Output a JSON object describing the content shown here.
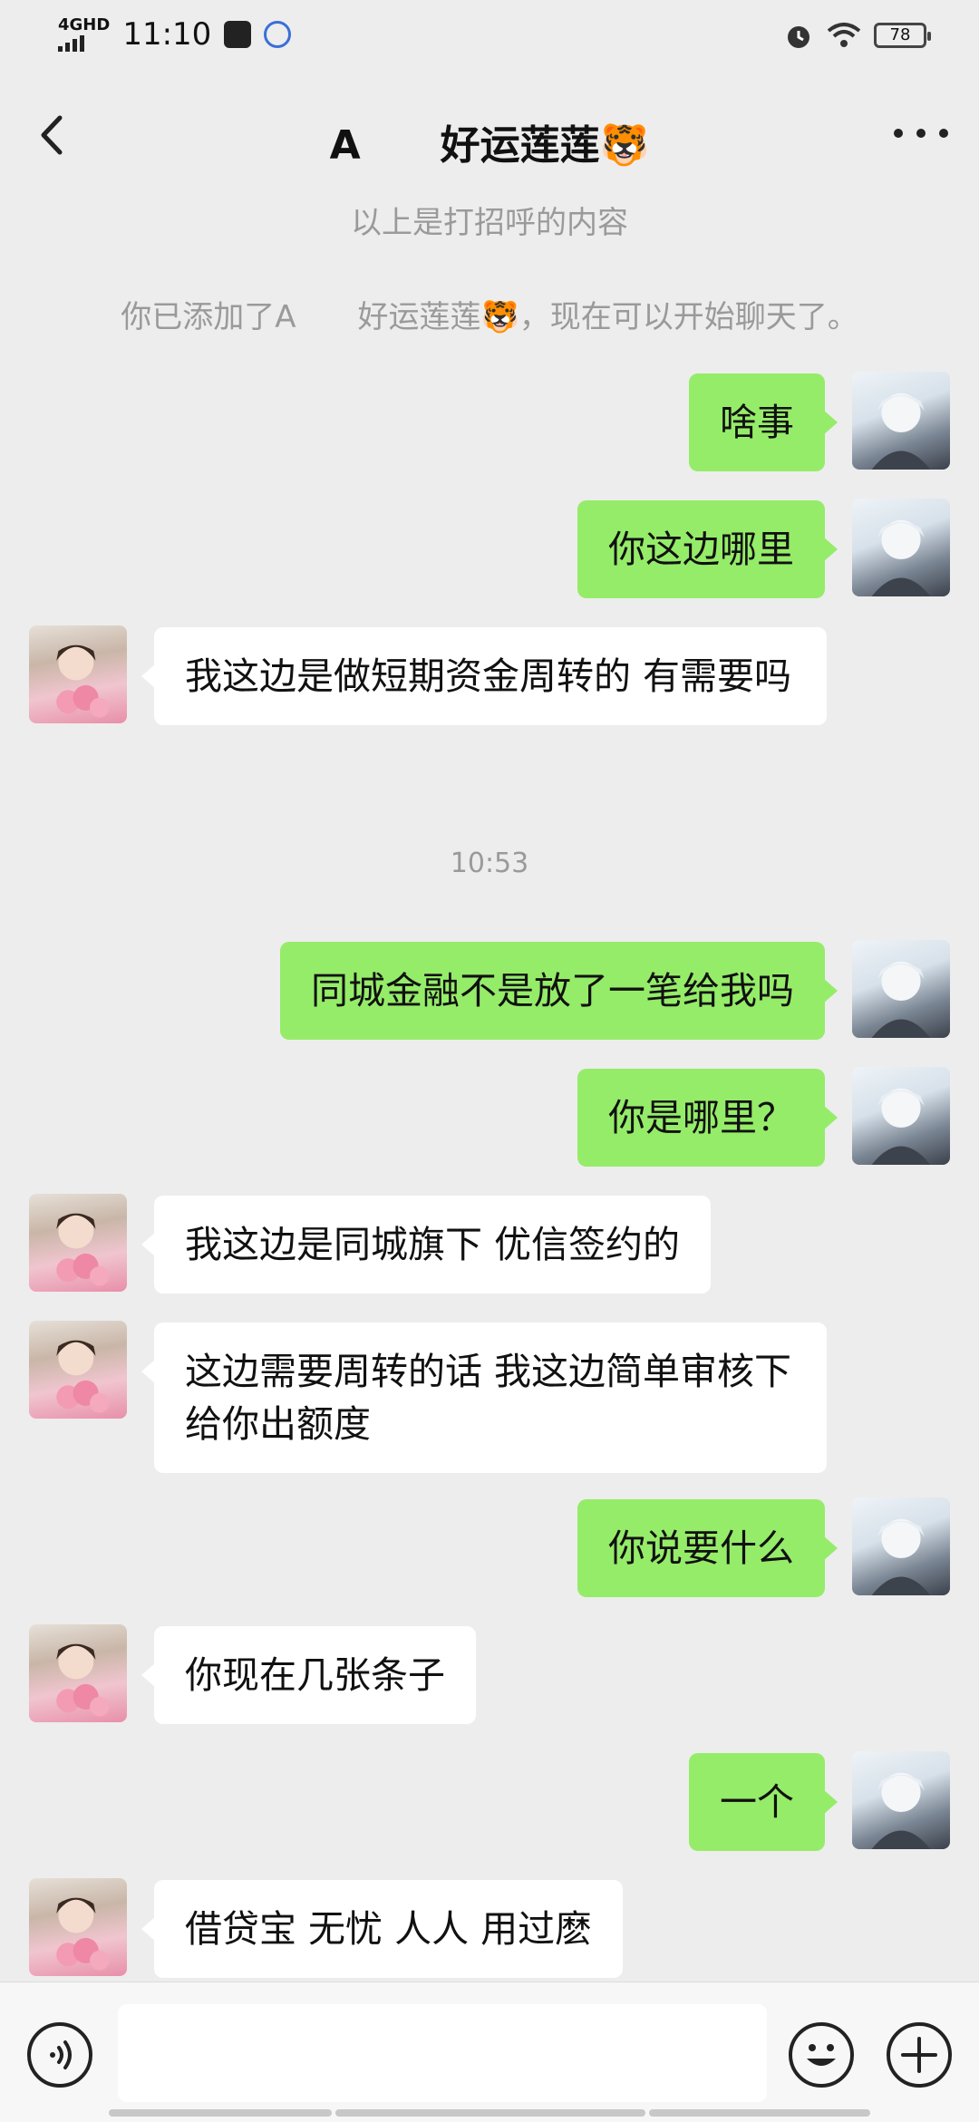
{
  "status_bar": {
    "network": "4GHD",
    "time": "11:10",
    "battery": "78"
  },
  "header": {
    "title": "A　　好运莲莲🐯"
  },
  "system_messages": [
    "以上是打招呼的内容",
    "你已添加了A　　好运莲莲🐯，现在可以开始聊天了。"
  ],
  "timestamp": "10:53",
  "messages": [
    {
      "from": "me",
      "text": "啥事"
    },
    {
      "from": "me",
      "text": "你这边哪里"
    },
    {
      "from": "other",
      "text": "我这边是做短期资金周转的 有需要吗"
    },
    {
      "from": "me",
      "text": "同城金融不是放了一笔给我吗"
    },
    {
      "from": "me",
      "text": "你是哪里？"
    },
    {
      "from": "other",
      "text": "我这边是同城旗下 优信签约的"
    },
    {
      "from": "other",
      "text": "这边需要周转的话 我这边简单审核下给你出额度"
    },
    {
      "from": "me",
      "text": "你说要什么"
    },
    {
      "from": "other",
      "text": "你现在几张条子"
    },
    {
      "from": "me",
      "text": "一个"
    },
    {
      "from": "other",
      "text": "借贷宝 无忧 人人 用过麽"
    }
  ],
  "input_bar": {
    "placeholder": ""
  },
  "icons": {
    "back": "chevron-left-icon",
    "more": "more-dots-icon",
    "voice": "voice-icon",
    "emoji": "emoji-icon",
    "plus": "plus-icon"
  }
}
